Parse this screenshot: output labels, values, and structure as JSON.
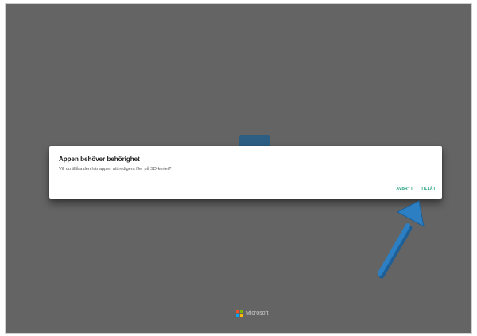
{
  "dialog": {
    "title": "Appen behöver behörighet",
    "message": "Vill du tillåta den här appen att redigera filer på SD-kortet?",
    "cancel_label": "AVBRYT",
    "allow_label": "TILLÅT"
  },
  "footer": {
    "brand": "Microsoft"
  },
  "colors": {
    "backdrop": "#646464",
    "action_text": "#1e9e7c",
    "arrow": "#2d7fc4"
  },
  "icons": {
    "brand_logo": "microsoft-logo-icon",
    "pointer": "blue-arrow-icon"
  }
}
